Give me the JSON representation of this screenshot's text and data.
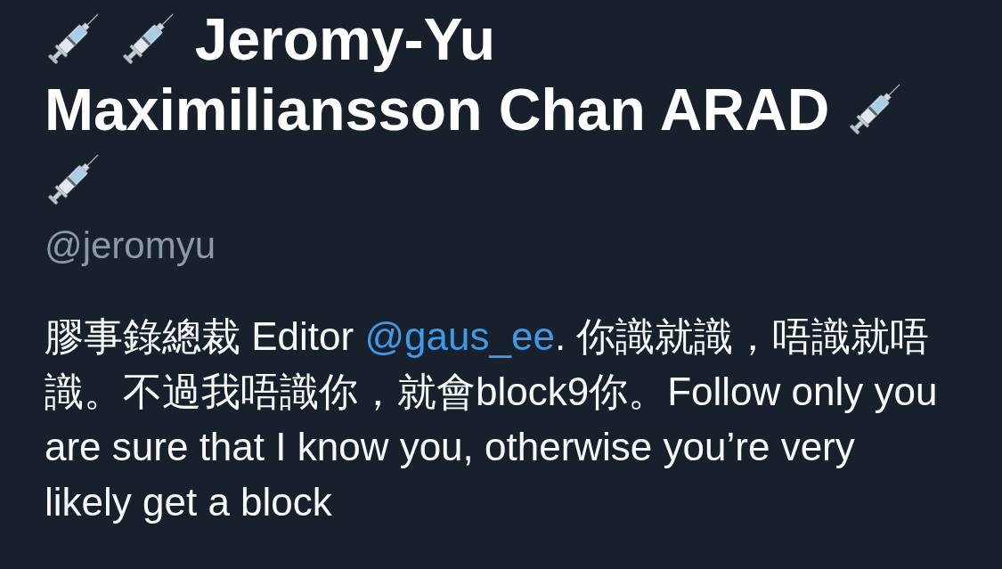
{
  "profile": {
    "name": [
      {
        "kind": "emoji"
      },
      {
        "kind": "emoji"
      },
      {
        "kind": "text",
        "text": "Jeromy-Yu"
      },
      {
        "kind": "text",
        "text": "Maximiliansson Chan ARAD"
      },
      {
        "kind": "emoji"
      },
      {
        "kind": "emoji"
      }
    ],
    "handle": "@jeromyu",
    "bio": [
      {
        "kind": "text",
        "text": "膠事錄總裁 Editor "
      },
      {
        "kind": "mention",
        "text": "@gaus_ee"
      },
      {
        "kind": "text",
        "text": ". 你識就識，唔識就唔識。不過我唔識你，就會block9你。Follow only you are sure that I know you, otherwise you’re very likely get a block"
      }
    ]
  }
}
